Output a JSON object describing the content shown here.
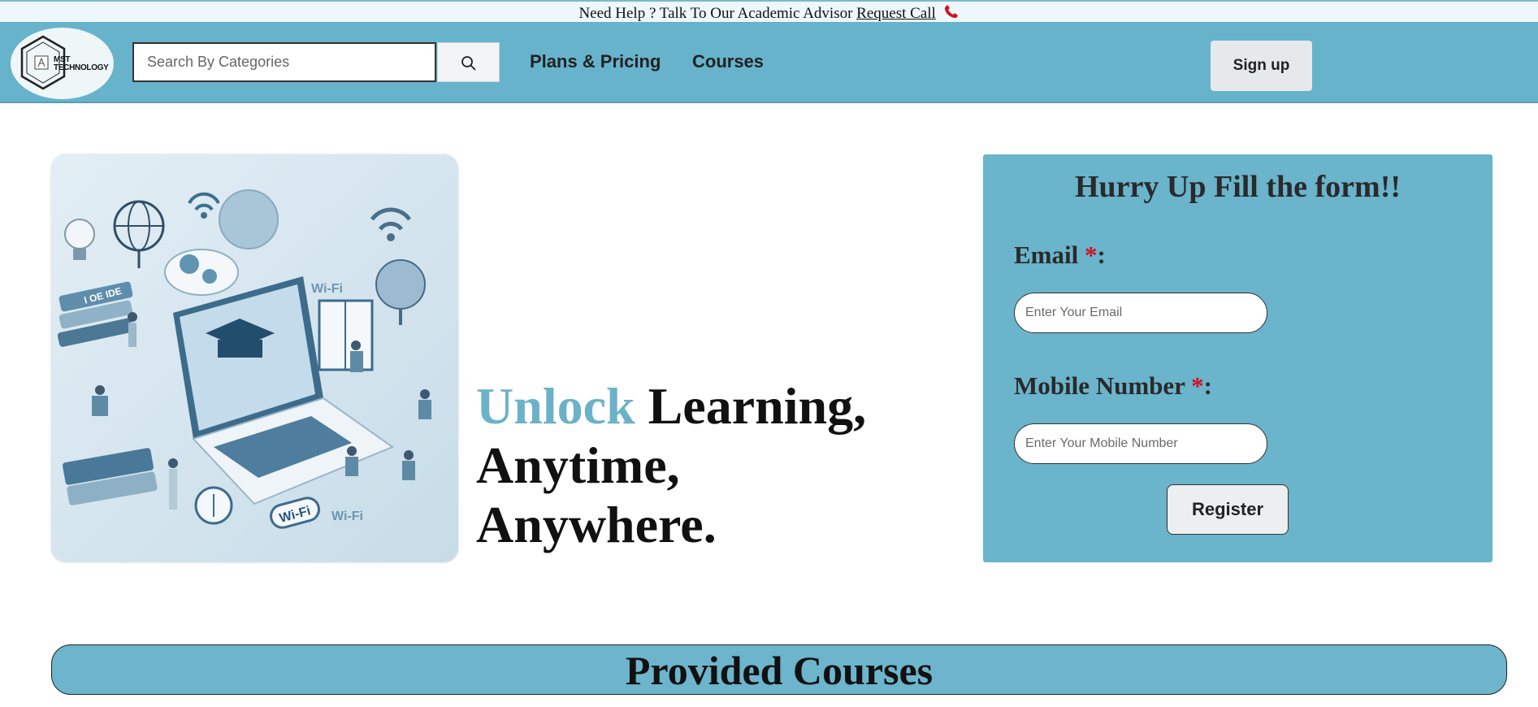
{
  "topbar": {
    "help_text": "Need Help ? Talk To Our Academic Advisor",
    "link_label": "Request Call"
  },
  "header": {
    "logo_text_line1": "MST",
    "logo_text_line2": "TECHNOLOGY",
    "search_placeholder": "Search By Categories",
    "nav": [
      "Plans & Pricing",
      "Courses"
    ],
    "signup_label": "Sign up"
  },
  "hero": {
    "tagline_accent": "Unlock",
    "tagline_rest_1": "Learning,",
    "tagline_line2": "Anytime,",
    "tagline_line3": "Anywhere.",
    "image_labels": {
      "book": "I OE IDE",
      "wifi_1": "Wi-Fi",
      "wifi_2": "Wi-Fi",
      "wifi_3": "Wi-Fi"
    }
  },
  "form": {
    "title": "Hurry Up Fill the form!!",
    "email_label": "Email",
    "email_placeholder": "Enter Your Email",
    "mobile_label": "Mobile Number",
    "mobile_placeholder": "Enter Your Mobile Number",
    "required_mark": "*",
    "label_suffix": ":",
    "register_label": "Register"
  },
  "courses_section": {
    "title": "Provided Courses"
  },
  "colors": {
    "accent": "#67b3cc",
    "required": "#d0101e"
  }
}
